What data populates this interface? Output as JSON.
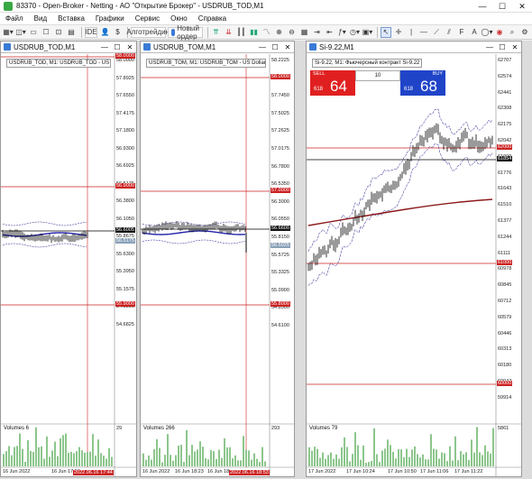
{
  "window": {
    "title": "83370 - Open-Broker - Netting - АО \"Открытие Брокер\" - USDRUB_TOD,M1"
  },
  "menu": [
    "Файл",
    "Вид",
    "Вставка",
    "Графики",
    "Сервис",
    "Окно",
    "Справка"
  ],
  "toolbar": {
    "ide": "IDE",
    "algo": "Алготрейдинг",
    "new_order": "Новый ордер"
  },
  "colors": {
    "red_line": "#cc2222",
    "price_line": "#000000",
    "band": "#1a1a8c",
    "ma": "#2222aa",
    "volume": "#1a8c1a",
    "ma_si": "#8c1a1a"
  },
  "charts": [
    {
      "window_title": "USDRUB_TOD,M1",
      "info": "USDRUB_TOD, M1:  USDRUB_TOD - US",
      "price_labels": [
        "58.0000",
        "57.8925",
        "57.6550",
        "57.4175",
        "57.1800",
        "56.9300",
        "56.6925",
        "56.5175",
        "56.3800",
        "56.1050",
        "55.8675",
        "55.6300",
        "55.3950",
        "55.1575",
        "54.9200",
        "54.6825"
      ],
      "price_tags": [
        {
          "text": "58.0000",
          "kind": "red"
        },
        {
          "text": "56.9000",
          "kind": "red"
        },
        {
          "text": "56.6005",
          "kind": "dark"
        },
        {
          "text": "56.5175",
          "kind": "grey"
        },
        {
          "text": "55.9000",
          "kind": "red"
        }
      ],
      "volume_label": "Volumes 6",
      "volume_scale": "29",
      "time_labels": [
        "16 Jun 2022",
        "16 Jun 17:18"
      ],
      "time_tag": "2022.06.16 17:44"
    },
    {
      "window_title": "USDRUB_TOM,M1",
      "info": "USDRUB_TOM, M1:  USDRUB_TOM - US Dollar",
      "price_labels": [
        "58.2225",
        "57.9825",
        "57.7450",
        "57.5025",
        "57.2625",
        "57.0175",
        "56.7800",
        "56.5350",
        "56.3000",
        "56.0550",
        "55.8150",
        "55.5725",
        "55.3325",
        "55.0900",
        "54.8500",
        "54.6100"
      ],
      "price_tags": [
        {
          "text": "58.0000",
          "kind": "red"
        },
        {
          "text": "57.0000",
          "kind": "red"
        },
        {
          "text": "56.6600",
          "kind": "dark"
        },
        {
          "text": "56.5025",
          "kind": "grey"
        },
        {
          "text": "55.8000",
          "kind": "red"
        }
      ],
      "volume_label": "Volumes 266",
      "volume_scale": "293",
      "time_labels": [
        "16 Jun 2022",
        "16 Jun 18:23",
        "16 Jun 18:"
      ],
      "time_tag": "2022.06.16 18:53"
    },
    {
      "window_title": "Si-9.22,M1",
      "info": "Si-9.22, M1:  Фьючерсный контракт Si-9.22",
      "price_labels": [
        "62707",
        "62574",
        "62441",
        "62308",
        "62175",
        "62042",
        "61909",
        "61776",
        "61643",
        "61510",
        "61377",
        "61244",
        "61111",
        "60978",
        "60845",
        "60712",
        "60579",
        "60446",
        "60313",
        "60180",
        "60047",
        "59914"
      ],
      "price_tags": [
        {
          "text": "62000",
          "kind": "red"
        },
        {
          "text": "61854",
          "kind": "dark"
        },
        {
          "text": "61000",
          "kind": "red"
        },
        {
          "text": "60000",
          "kind": "red"
        }
      ],
      "volume_label": "Volumes 79",
      "volume_scale": "5861",
      "time_labels": [
        "17 Jun 2022",
        "17 Jun 10:24",
        "17 Jun 10:50",
        "17 Jun 11:06",
        "17 Jun 11:22"
      ],
      "trade": {
        "sell": "SELL",
        "buy": "BUY",
        "lot": "10",
        "sell_small": "618",
        "sell_big": "64",
        "buy_small": "618",
        "buy_big": "68"
      }
    }
  ]
}
